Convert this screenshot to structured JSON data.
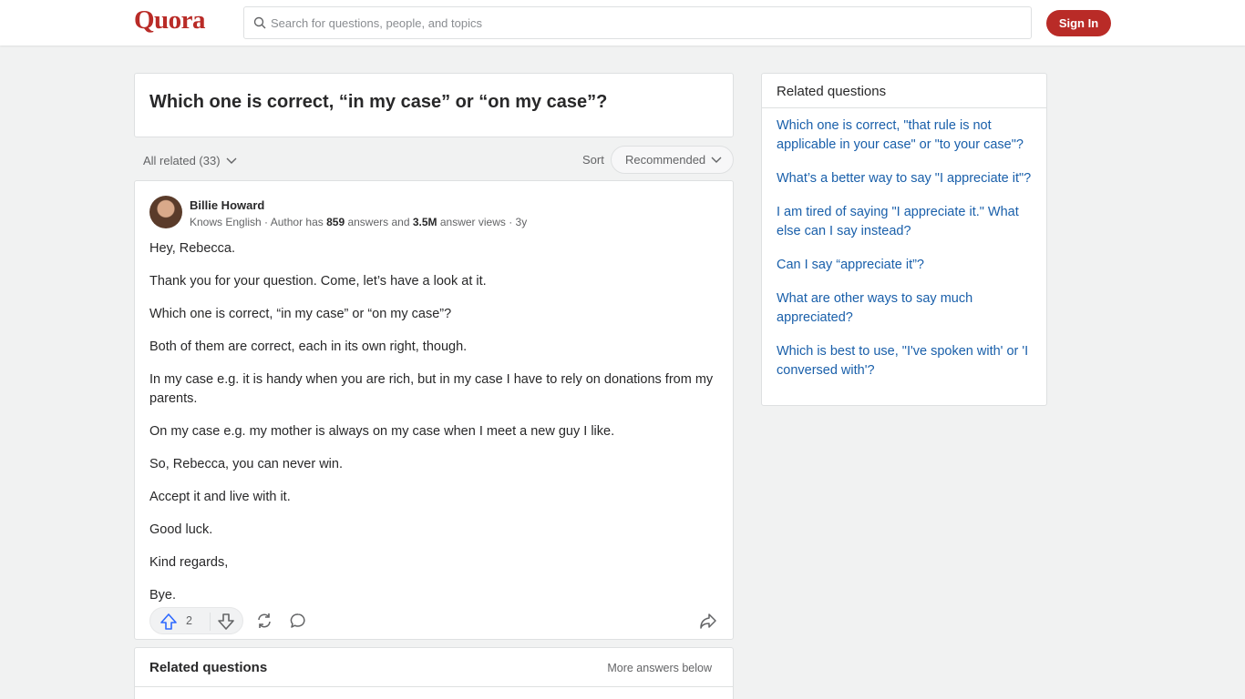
{
  "header": {
    "logo": "Quora",
    "search_placeholder": "Search for questions, people, and topics",
    "signin_label": "Sign In"
  },
  "question": {
    "title": "Which one is correct, “in my case” or “on my case”?"
  },
  "filters": {
    "all_related": "All related (33)",
    "sort_label": "Sort",
    "sort_value": "Recommended"
  },
  "answer": {
    "author_name": "Billie Howard",
    "meta_prefix": "Knows English · Author has ",
    "answer_count": "859",
    "meta_mid": " answers and ",
    "view_count": "3.5M",
    "meta_suffix": " answer views · 3y",
    "paragraphs": [
      "Hey, Rebecca.",
      "Thank you for your question. Come, let’s have a look at it.",
      "Which one is correct, “in my case” or “on my case”?",
      "Both of them are correct, each in its own right, though.",
      "In my case e.g. it is handy when you are rich, but in my case I have to rely on donations from my parents.",
      "On my case e.g. my mother is always on my case when I meet a new guy I like.",
      "So, Rebecca, you can never win.",
      "Accept it and live with it.",
      "Good luck.",
      "Kind regards,",
      "Bye."
    ],
    "upvote_count": "2"
  },
  "related_bottom": {
    "title": "Related questions",
    "more_answers": "More answers below"
  },
  "sidebar": {
    "title": "Related questions",
    "items": [
      "Which one is correct, \"that rule is not applicable in your case\" or \"to your case\"?",
      "What’s a better way to say \"I appreciate it\"?",
      "I am tired of saying \"I appreciate it.\" What else can I say instead?",
      "Can I say “appreciate it”?",
      "What are other ways to say much appreciated?",
      "Which is best to use, \"I've spoken with' or 'I conversed with'?"
    ]
  },
  "colors": {
    "brand": "#b92b27",
    "link": "#195faa",
    "background": "#f1f2f2"
  },
  "icons": [
    "search-icon",
    "chevron-down-icon",
    "upvote-icon",
    "downvote-icon",
    "reshare-icon",
    "comment-icon",
    "share-icon"
  ]
}
